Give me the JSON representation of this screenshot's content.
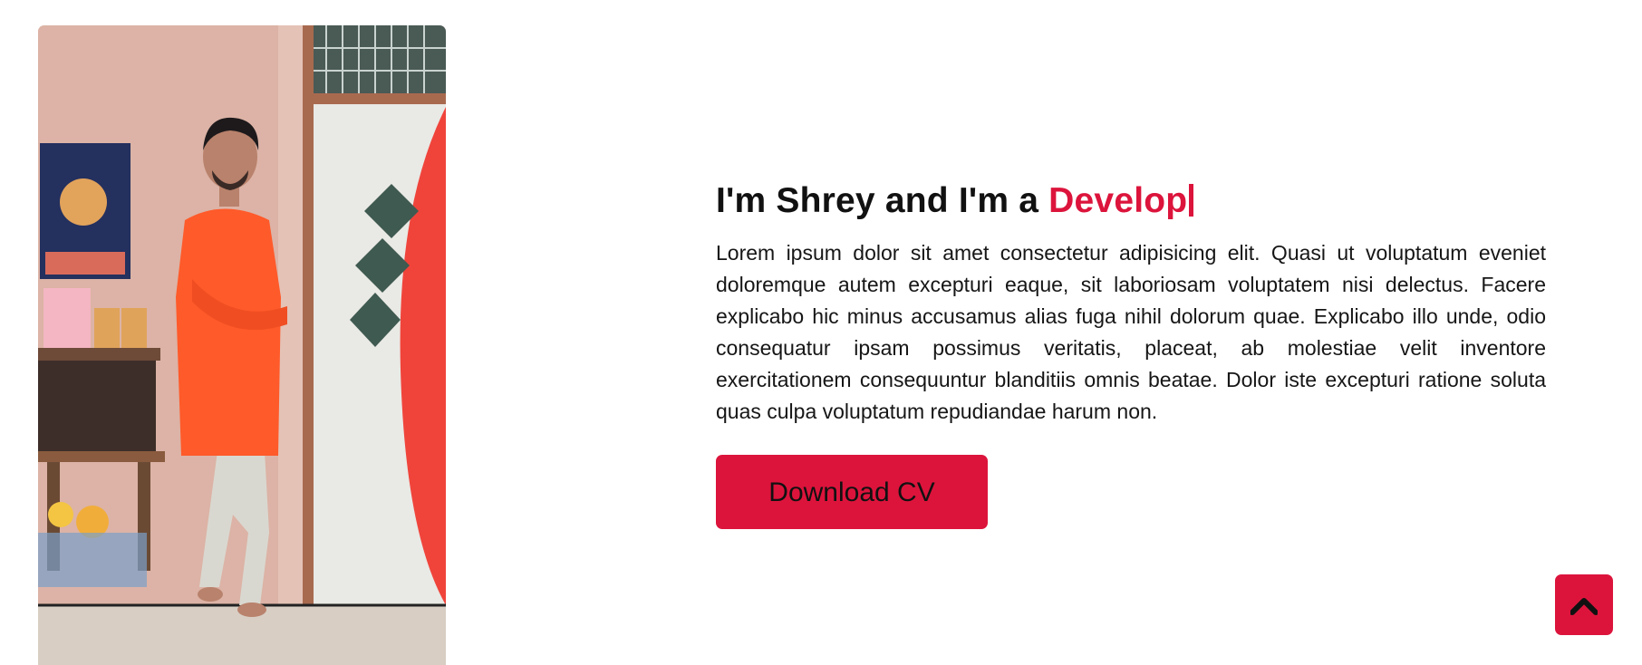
{
  "about": {
    "photo_alt": "Portrait photo",
    "heading_prefix": "I'm Shrey and I'm a ",
    "heading_role": "Develop",
    "description": "Lorem ipsum dolor sit amet consectetur adipisicing elit. Quasi ut voluptatum eveniet doloremque autem excepturi eaque, sit laboriosam voluptatem nisi delectus. Facere explicabo hic minus accusamus alias fuga nihil dolorum quae. Explicabo illo unde, odio consequatur ipsam possimus veritatis, placeat, ab molestiae velit inventore exercitationem consequuntur blanditiis omnis beatae. Dolor iste excepturi ratione soluta quas culpa voluptatum repudiandae harum non.",
    "button_label": "Download CV"
  },
  "scroll_top": {
    "icon": "chevron-up-icon"
  },
  "colors": {
    "accent": "#dc143c",
    "text": "#111111",
    "background": "#ffffff"
  }
}
